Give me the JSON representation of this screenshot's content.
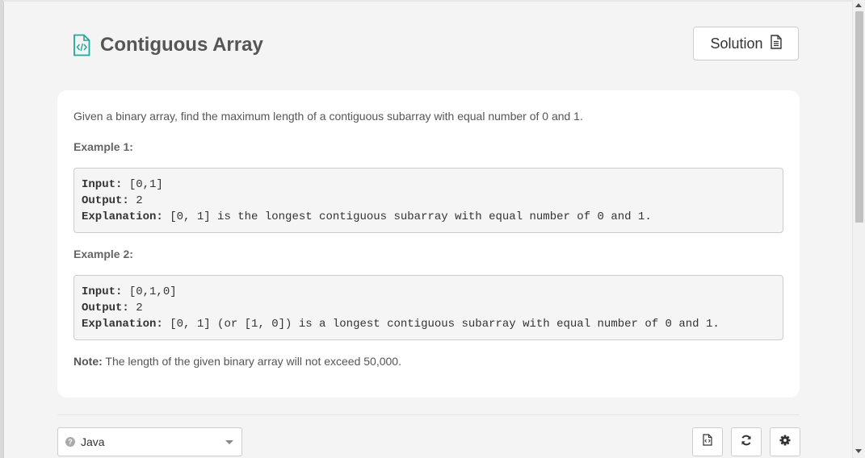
{
  "problem": {
    "title": "Contiguous Array",
    "description": "Given a binary array, find the maximum length of a contiguous subarray with equal number of 0 and 1."
  },
  "header": {
    "solution_label": "Solution"
  },
  "examples": [
    {
      "title": "Example 1:",
      "input_label": "Input:",
      "input_value": " [0,1]",
      "output_label": "Output:",
      "output_value": " 2",
      "explanation_label": "Explanation:",
      "explanation_value": " [0, 1] is the longest contiguous subarray with equal number of 0 and 1."
    },
    {
      "title": "Example 2:",
      "input_label": "Input:",
      "input_value": " [0,1,0]",
      "output_label": "Output:",
      "output_value": " 2",
      "explanation_label": "Explanation:",
      "explanation_value": " [0, 1] (or [1, 0]) is a longest contiguous subarray with equal number of 0 and 1."
    }
  ],
  "note": {
    "label": "Note:",
    "text": " The length of the given binary array will not exceed 50,000."
  },
  "editor": {
    "language": "Java",
    "help_glyph": "?"
  },
  "colors": {
    "accent": "#26a69a",
    "text": "#555555",
    "card": "#ffffff",
    "page": "#f4f4f4"
  }
}
